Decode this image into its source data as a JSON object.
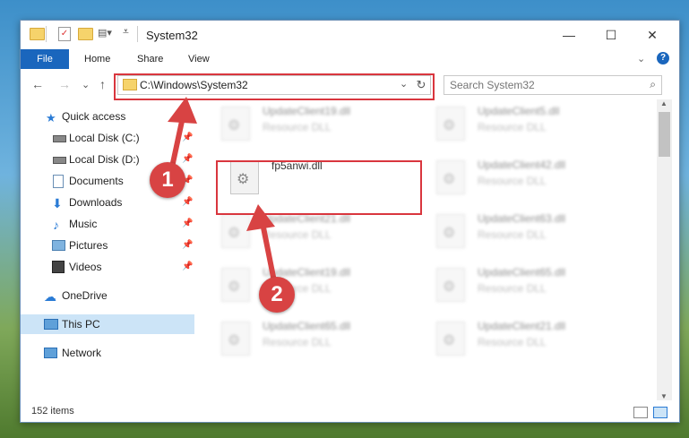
{
  "window": {
    "title": "System32",
    "controls": {
      "minimize": "—",
      "maximize": "☐",
      "close": "✕"
    }
  },
  "ribbon": {
    "tabs": [
      "File",
      "Home",
      "Share",
      "View"
    ],
    "expand": "⌄",
    "help": "?"
  },
  "navigation": {
    "back": "←",
    "forward": "→",
    "recent": "⌄",
    "up": "↑",
    "address": "C:\\Windows\\System32",
    "address_dropdown": "⌄",
    "refresh": "↻",
    "search_placeholder": "Search System32"
  },
  "sidebar": {
    "items": [
      {
        "label": "Quick access",
        "icon": "star-icon",
        "pinned": false
      },
      {
        "label": "Local Disk (C:)",
        "icon": "drive-icon",
        "pinned": true
      },
      {
        "label": "Local Disk (D:)",
        "icon": "drive-icon",
        "pinned": true
      },
      {
        "label": "Documents",
        "icon": "documents-icon",
        "pinned": true
      },
      {
        "label": "Downloads",
        "icon": "download-icon",
        "pinned": true
      },
      {
        "label": "Music",
        "icon": "music-icon",
        "pinned": true
      },
      {
        "label": "Pictures",
        "icon": "pictures-icon",
        "pinned": true
      },
      {
        "label": "Videos",
        "icon": "videos-icon",
        "pinned": true
      },
      {
        "label": "OneDrive",
        "icon": "cloud-icon",
        "pinned": false
      },
      {
        "label": "This PC",
        "icon": "computer-icon",
        "pinned": false,
        "selected": true
      },
      {
        "label": "Network",
        "icon": "network-icon",
        "pinned": false
      }
    ]
  },
  "files": {
    "highlighted": {
      "name": "fp5anwi.dll"
    },
    "left_column": [
      {
        "name": "UpdateClient19.dll",
        "type": "Resource DLL"
      },
      {
        "name": "UpdateClient21.dll",
        "type": "Resource DLL"
      },
      {
        "name": "UpdateClient19.dll",
        "type": "Resource DLL"
      },
      {
        "name": "UpdateClient65.dll",
        "type": "Resource DLL"
      }
    ],
    "right_column": [
      {
        "name": "UpdateClient5.dll",
        "type": "Resource DLL"
      },
      {
        "name": "UpdateClient42.dll",
        "type": "Resource DLL"
      },
      {
        "name": "UpdateClient63.dll",
        "type": "Resource DLL"
      },
      {
        "name": "UpdateClient65.dll",
        "type": "Resource DLL"
      },
      {
        "name": "UpdateClient21.dll",
        "type": "Resource DLL"
      }
    ]
  },
  "status": {
    "item_count": "152 items"
  },
  "annotations": {
    "step1": "1",
    "step2": "2"
  },
  "colors": {
    "highlight_red": "#d9363e",
    "file_tab_blue": "#1a66bd",
    "selected_bg": "#cce4f7"
  }
}
